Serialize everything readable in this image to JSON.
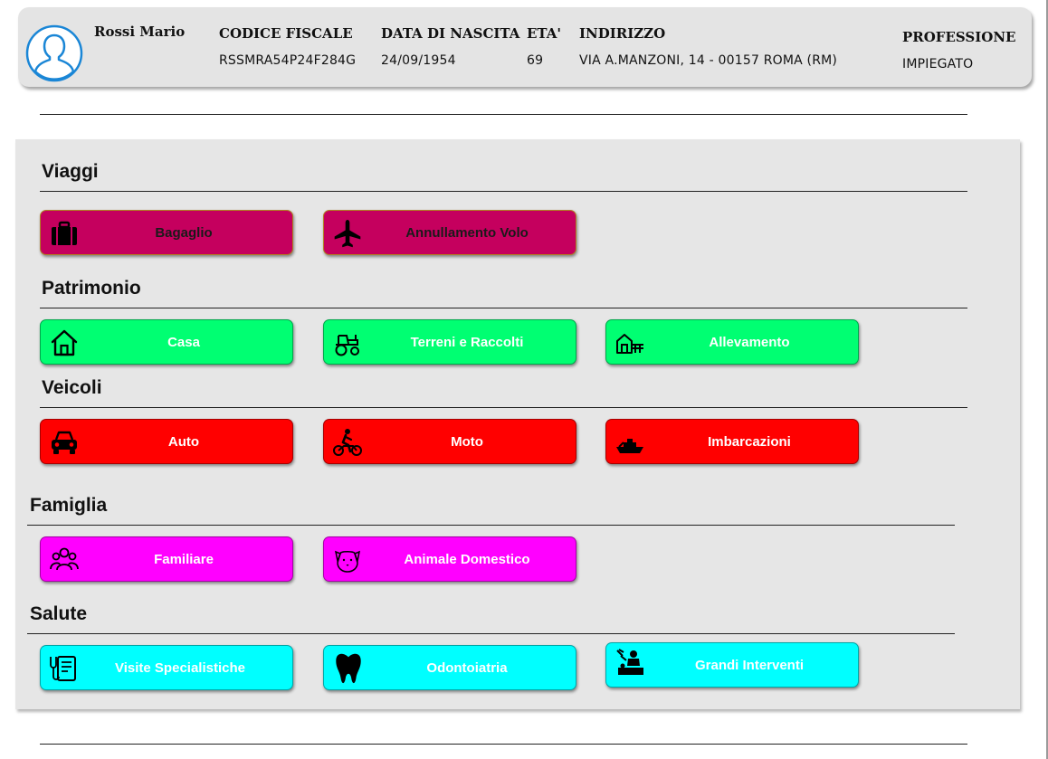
{
  "patient": {
    "name": "Rossi Mario",
    "headers": {
      "codice_fiscale": "CODICE FISCALE",
      "data_nascita": "DATA DI NASCITA",
      "eta": "ETA'",
      "indirizzo": "INDIRIZZO",
      "professione": "PROFESSIONE"
    },
    "values": {
      "codice_fiscale": "RSSMRA54P24F284G",
      "data_nascita": "24/09/1954",
      "eta": "69",
      "indirizzo": "VIA A.MANZONI, 14 - 00157 ROMA (RM)",
      "professione": "IMPIEGATO"
    }
  },
  "sections": {
    "viaggi": {
      "title": "Viaggi",
      "color": "#c5005e",
      "tiles": [
        {
          "label": "Bagaglio",
          "icon": "luggage-icon"
        },
        {
          "label": "Annullamento Volo",
          "icon": "airplane-icon"
        }
      ]
    },
    "patrimonio": {
      "title": "Patrimonio",
      "color": "#00ff72",
      "tiles": [
        {
          "label": "Casa",
          "icon": "house-icon"
        },
        {
          "label": "Terreni e Raccolti",
          "icon": "tractor-icon"
        },
        {
          "label": "Allevamento",
          "icon": "barn-icon"
        }
      ]
    },
    "veicoli": {
      "title": "Veicoli",
      "color": "#ff0000",
      "tiles": [
        {
          "label": "Auto",
          "icon": "car-icon"
        },
        {
          "label": "Moto",
          "icon": "motorcycle-icon"
        },
        {
          "label": "Imbarcazioni",
          "icon": "boat-icon"
        }
      ]
    },
    "famiglia": {
      "title": "Famiglia",
      "color": "#ff00ff",
      "tiles": [
        {
          "label": "Familiare",
          "icon": "family-icon"
        },
        {
          "label": "Animale Domestico",
          "icon": "dog-icon"
        }
      ]
    },
    "salute": {
      "title": "Salute",
      "color": "#00ffff",
      "tiles": [
        {
          "label": "Visite Specialistiche",
          "icon": "medical-record-icon"
        },
        {
          "label": "Odontoiatria",
          "icon": "tooth-icon"
        },
        {
          "label": "Grandi Interventi",
          "icon": "surgery-icon"
        }
      ]
    }
  }
}
